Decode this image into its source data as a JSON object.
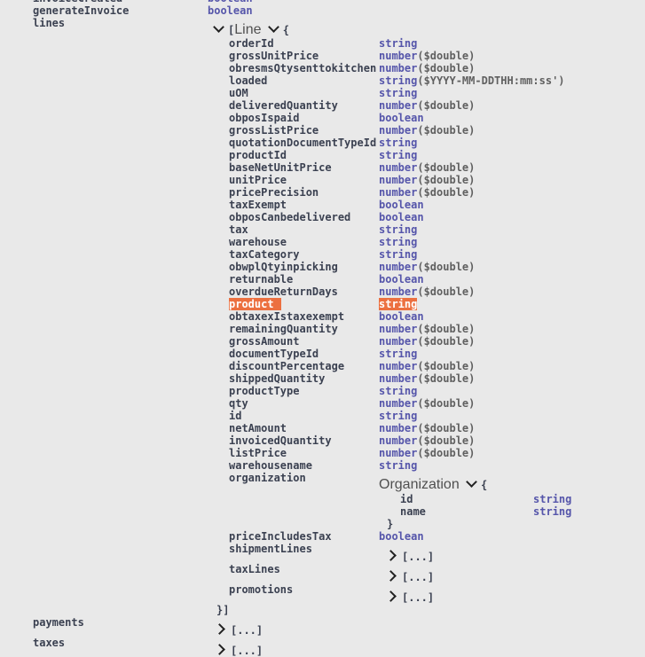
{
  "top_rows": [
    {
      "name": "invoiceCreated",
      "type": "boolean"
    },
    {
      "name": "generateInvoice",
      "type": "boolean"
    },
    {
      "name": "lines",
      "type": ""
    }
  ],
  "line_model": {
    "open_bracket": "[",
    "title": "Line",
    "open_brace": "{",
    "close": "}]"
  },
  "line_rows": [
    {
      "name": "orderId",
      "type": "string",
      "format": ""
    },
    {
      "name": "grossUnitPrice",
      "type": "number",
      "format": "($double)"
    },
    {
      "name": "obresmsQtysenttokitchen",
      "type": "number",
      "format": "($double)"
    },
    {
      "name": "loaded",
      "type": "string",
      "format": "($YYYY-MM-DDTHH:mm:ss')"
    },
    {
      "name": "uOM",
      "type": "string",
      "format": ""
    },
    {
      "name": "deliveredQuantity",
      "type": "number",
      "format": "($double)"
    },
    {
      "name": "obposIspaid",
      "type": "boolean",
      "format": ""
    },
    {
      "name": "grossListPrice",
      "type": "number",
      "format": "($double)"
    },
    {
      "name": "quotationDocumentTypeId",
      "type": "string",
      "format": ""
    },
    {
      "name": "productId",
      "type": "string",
      "format": ""
    },
    {
      "name": "baseNetUnitPrice",
      "type": "number",
      "format": "($double)"
    },
    {
      "name": "unitPrice",
      "type": "number",
      "format": "($double)"
    },
    {
      "name": "pricePrecision",
      "type": "number",
      "format": "($double)"
    },
    {
      "name": "taxExempt",
      "type": "boolean",
      "format": ""
    },
    {
      "name": "obposCanbedelivered",
      "type": "boolean",
      "format": ""
    },
    {
      "name": "tax",
      "type": "string",
      "format": ""
    },
    {
      "name": "warehouse",
      "type": "string",
      "format": ""
    },
    {
      "name": "taxCategory",
      "type": "string",
      "format": ""
    },
    {
      "name": "obwplQtyinpicking",
      "type": "number",
      "format": "($double)"
    },
    {
      "name": "returnable",
      "type": "boolean",
      "format": ""
    },
    {
      "name": "overdueReturnDays",
      "type": "number",
      "format": "($double)"
    },
    {
      "name": "product",
      "type": "string",
      "format": "",
      "highlighted": true
    },
    {
      "name": "obtaxexIstaxexempt",
      "type": "boolean",
      "format": ""
    },
    {
      "name": "remainingQuantity",
      "type": "number",
      "format": "($double)"
    },
    {
      "name": "grossAmount",
      "type": "number",
      "format": "($double)"
    },
    {
      "name": "documentTypeId",
      "type": "string",
      "format": ""
    },
    {
      "name": "discountPercentage",
      "type": "number",
      "format": "($double)"
    },
    {
      "name": "shippedQuantity",
      "type": "number",
      "format": "($double)"
    },
    {
      "name": "productType",
      "type": "string",
      "format": ""
    },
    {
      "name": "qty",
      "type": "number",
      "format": "($double)"
    },
    {
      "name": "id",
      "type": "string",
      "format": ""
    },
    {
      "name": "netAmount",
      "type": "number",
      "format": "($double)"
    },
    {
      "name": "invoicedQuantity",
      "type": "number",
      "format": "($double)"
    },
    {
      "name": "listPrice",
      "type": "number",
      "format": "($double)"
    },
    {
      "name": "warehousename",
      "type": "string",
      "format": ""
    }
  ],
  "organization": {
    "name": "organization",
    "title": "Organization",
    "open_brace": "{",
    "close": "}",
    "rows": [
      {
        "name": "id",
        "type": "string"
      },
      {
        "name": "name",
        "type": "string"
      }
    ]
  },
  "price_includes_tax": {
    "name": "priceIncludesTax",
    "type": "boolean"
  },
  "collapsed_rows": [
    {
      "name": "shipmentLines",
      "label": "[...]"
    },
    {
      "name": "taxLines",
      "label": "[...]"
    },
    {
      "name": "promotions",
      "label": "[...]"
    }
  ],
  "bottom_rows": [
    {
      "name": "payments",
      "label": "[...]"
    },
    {
      "name": "taxes",
      "label": "[...]"
    }
  ]
}
